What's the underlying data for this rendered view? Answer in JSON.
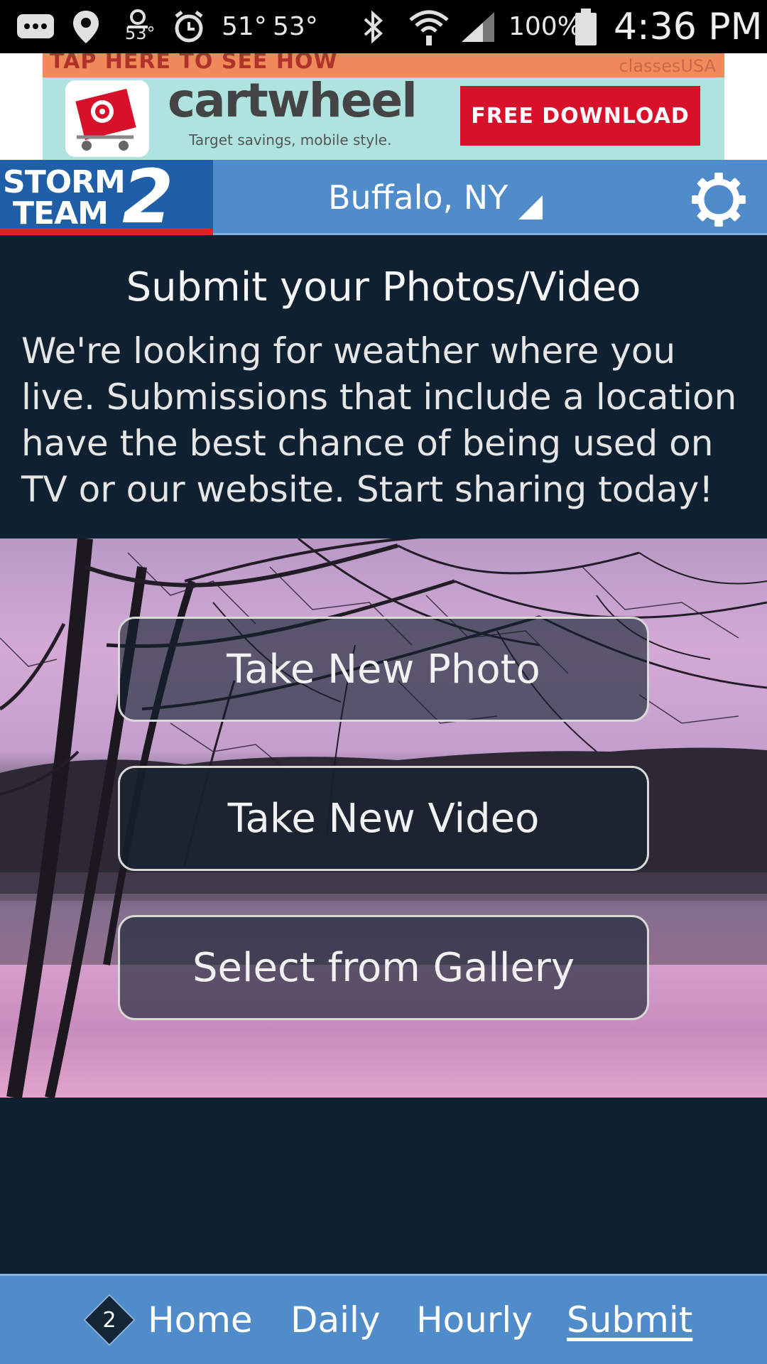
{
  "status_bar": {
    "weather_temp": "53°",
    "temp_low": "51°",
    "temp_high": "53°",
    "battery": "100%",
    "time": "4:36 PM",
    "icons": [
      "message-icon",
      "location-pin-icon",
      "weather-icon",
      "alarm-icon",
      "bluetooth-icon",
      "wifi-icon",
      "signal-icon",
      "battery-icon"
    ]
  },
  "ad": {
    "strip_text": "TAP HERE TO SEE HOW",
    "brand_small": "classesUSA",
    "title": "cartwheel",
    "subtitle": "Target savings, mobile style.",
    "cta": "FREE DOWNLOAD"
  },
  "header": {
    "logo_line1": "STORM",
    "logo_line2": "TEAM",
    "logo_number": "2",
    "location": "Buffalo, NY"
  },
  "intro": {
    "title": "Submit your Photos/Video",
    "body": "We're looking for weather where you live. Submissions that include a location have the best chance of being used on TV or our website. Start sharing today!"
  },
  "actions": {
    "take_photo": "Take New Photo",
    "take_video": "Take New Video",
    "gallery": "Select from Gallery"
  },
  "nav": {
    "badge": "2",
    "home": "Home",
    "daily": "Daily",
    "hourly": "Hourly",
    "submit": "Submit",
    "active": "submit"
  },
  "colors": {
    "header_blue": "#4f8cc9",
    "background_navy": "#0f2030",
    "ad_cta_red": "#d8112a"
  }
}
